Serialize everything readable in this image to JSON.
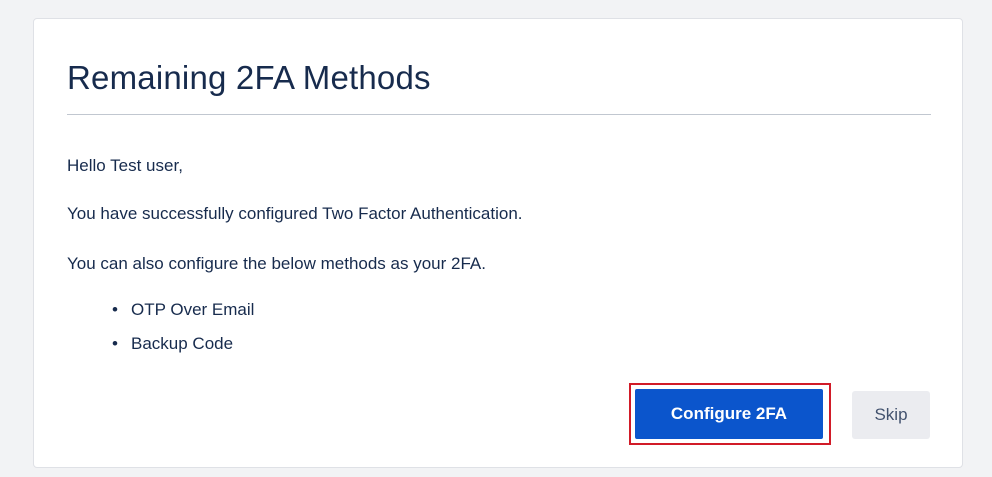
{
  "dialog": {
    "title": "Remaining 2FA Methods",
    "greeting": "Hello Test user,",
    "success_message": "You have successfully configured Two Factor Authentication.",
    "info_message": "You can also configure the below methods as your 2FA.",
    "methods": [
      {
        "label": "OTP Over Email"
      },
      {
        "label": "Backup Code"
      }
    ],
    "bullet": "•"
  },
  "actions": {
    "configure_label": "Configure 2FA",
    "skip_label": "Skip"
  },
  "colors": {
    "primary_button": "#0b55cc",
    "highlight_border": "#d11b28",
    "secondary_button": "#ebecf0",
    "text": "#172b4d"
  }
}
